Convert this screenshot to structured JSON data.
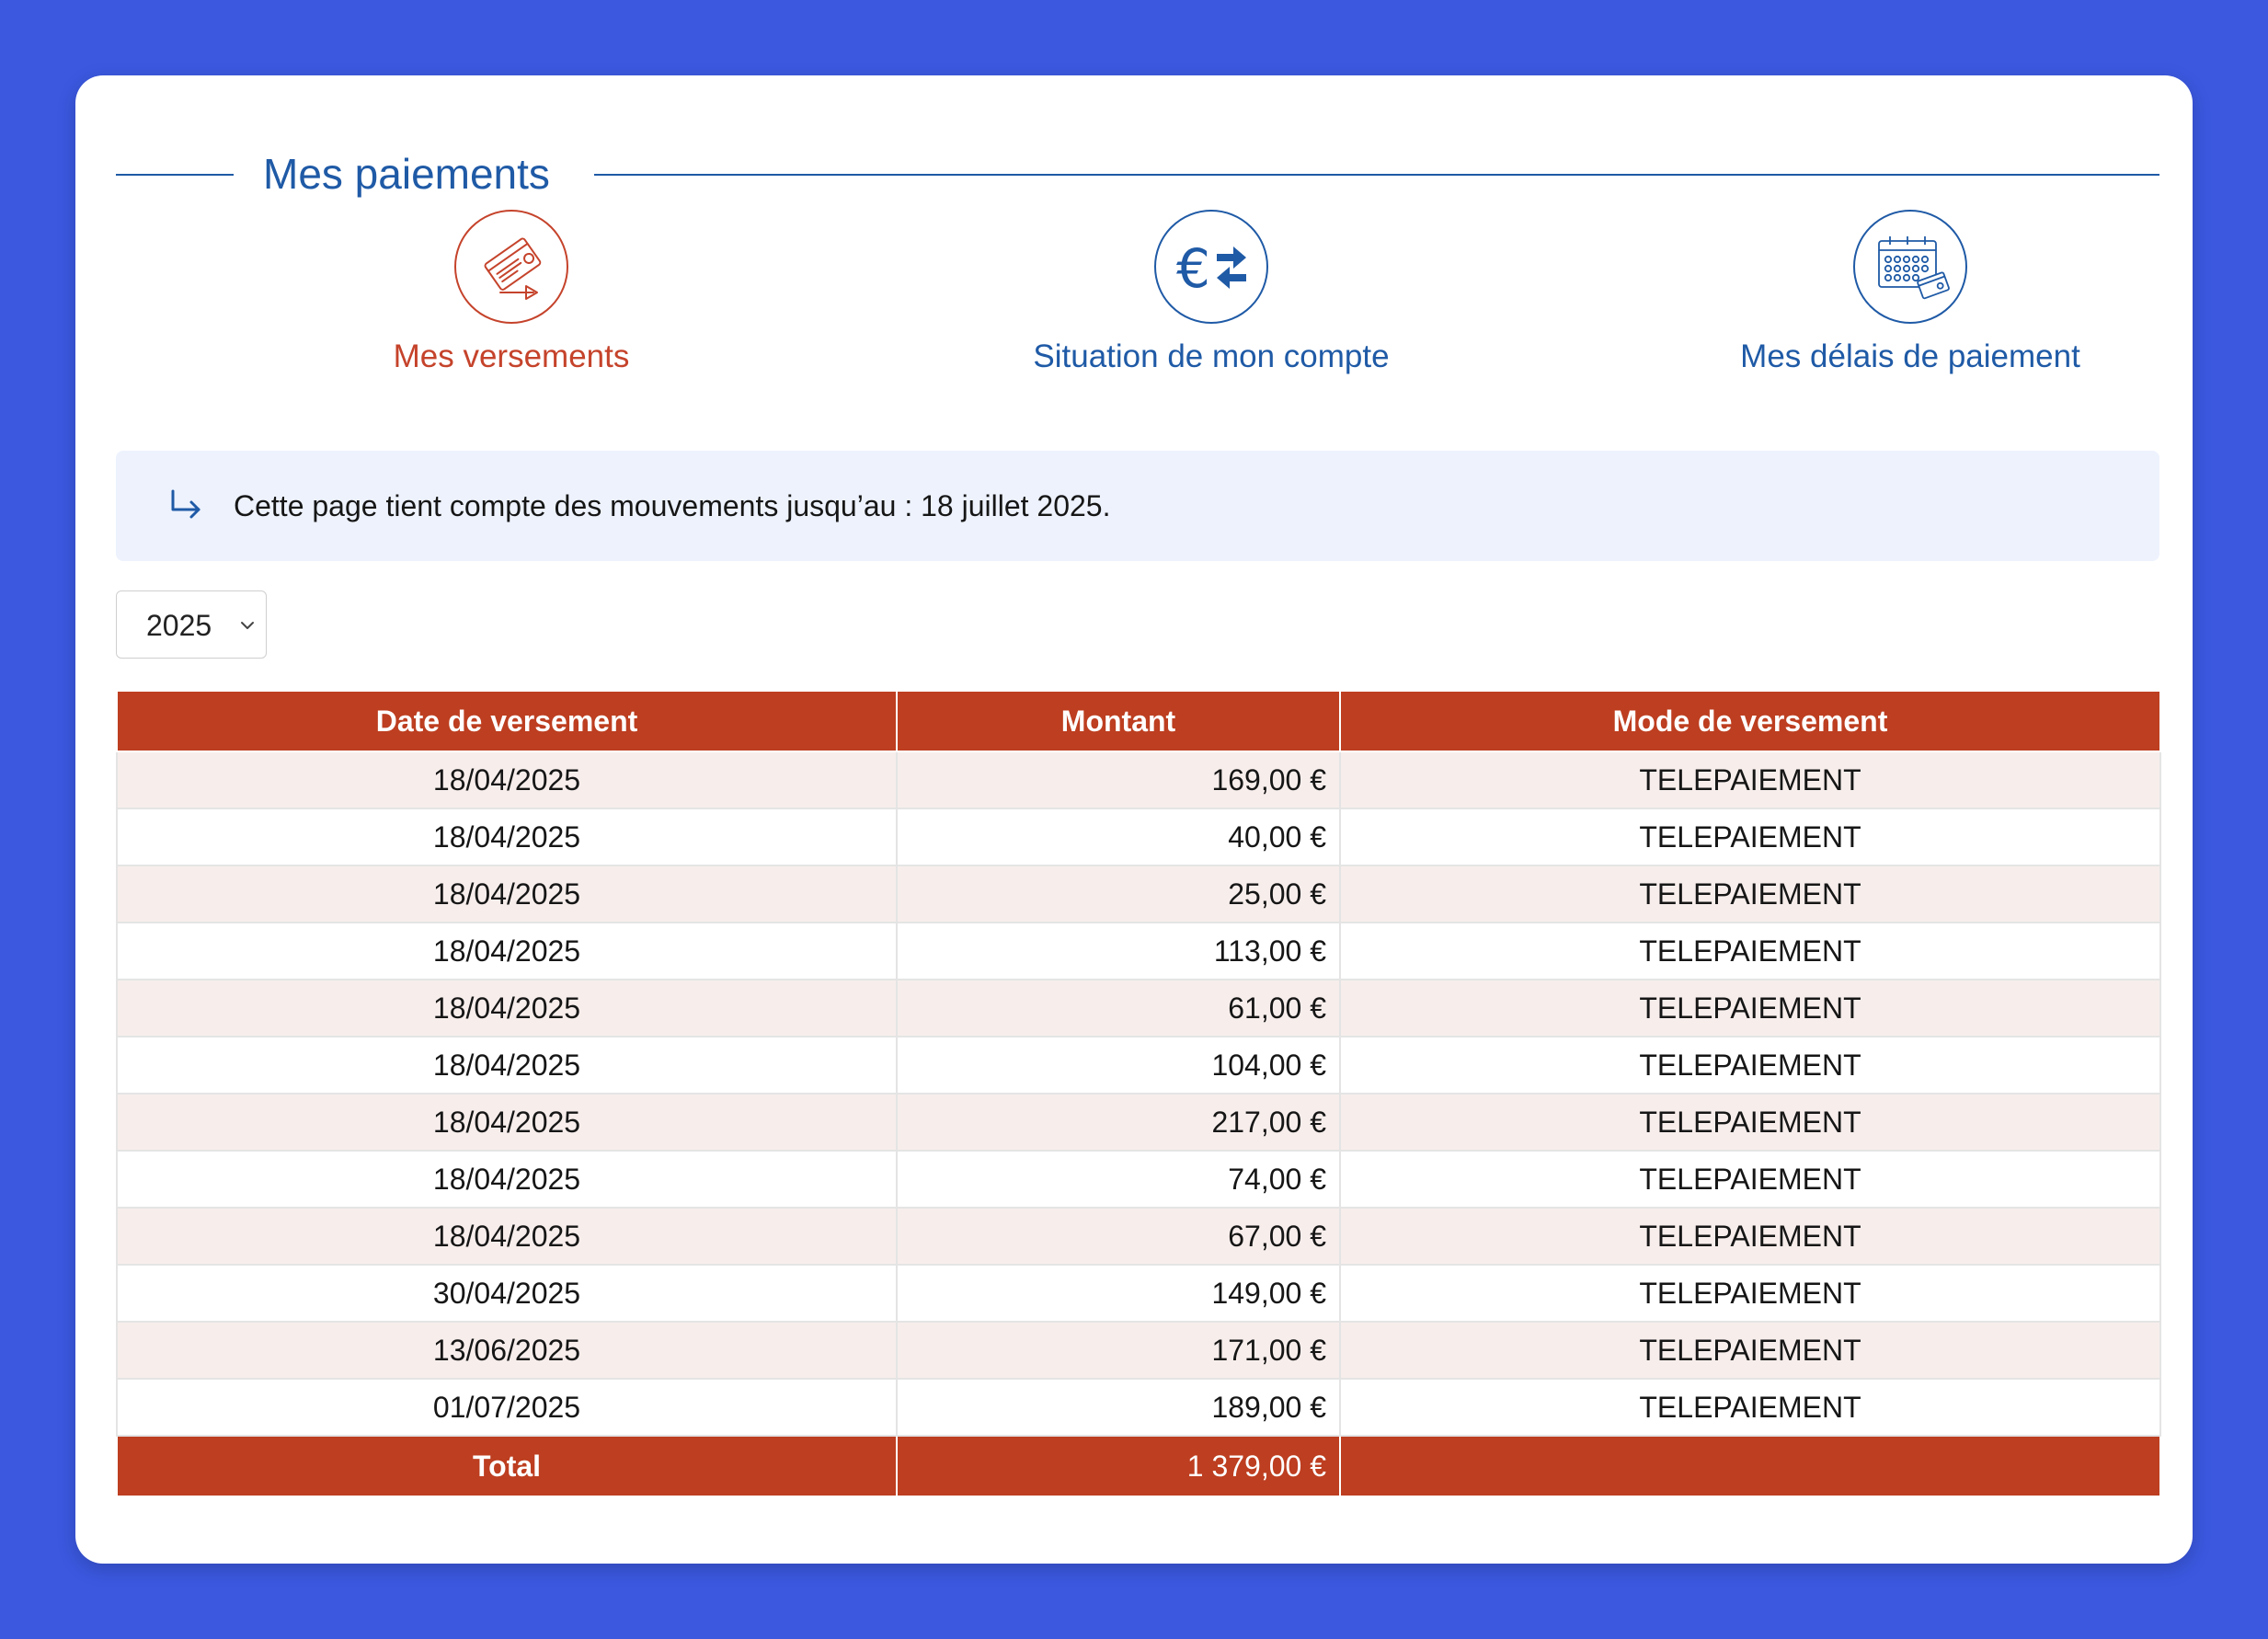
{
  "title": "Mes paiements",
  "nav": [
    {
      "label": "Mes versements",
      "icon": "credit-card-payment-icon"
    },
    {
      "label": "Situation de mon compte",
      "icon": "euro-exchange-icon"
    },
    {
      "label": "Mes délais de paiement",
      "icon": "calendar-payment-icon"
    }
  ],
  "info": {
    "text": "Cette page tient compte des mouvements jusqu’au : 18 juillet 2025.",
    "icon": "return-arrow-icon"
  },
  "year_select": {
    "value": "2025"
  },
  "table": {
    "headers": [
      "Date de versement",
      "Montant",
      "Mode de versement"
    ],
    "rows": [
      {
        "date": "18/04/2025",
        "amount": "169,00 €",
        "mode": "TELEPAIEMENT"
      },
      {
        "date": "18/04/2025",
        "amount": "40,00 €",
        "mode": "TELEPAIEMENT"
      },
      {
        "date": "18/04/2025",
        "amount": "25,00 €",
        "mode": "TELEPAIEMENT"
      },
      {
        "date": "18/04/2025",
        "amount": "113,00 €",
        "mode": "TELEPAIEMENT"
      },
      {
        "date": "18/04/2025",
        "amount": "61,00 €",
        "mode": "TELEPAIEMENT"
      },
      {
        "date": "18/04/2025",
        "amount": "104,00 €",
        "mode": "TELEPAIEMENT"
      },
      {
        "date": "18/04/2025",
        "amount": "217,00 €",
        "mode": "TELEPAIEMENT"
      },
      {
        "date": "18/04/2025",
        "amount": "74,00 €",
        "mode": "TELEPAIEMENT"
      },
      {
        "date": "18/04/2025",
        "amount": "67,00 €",
        "mode": "TELEPAIEMENT"
      },
      {
        "date": "30/04/2025",
        "amount": "149,00 €",
        "mode": "TELEPAIEMENT"
      },
      {
        "date": "13/06/2025",
        "amount": "171,00 €",
        "mode": "TELEPAIEMENT"
      },
      {
        "date": "01/07/2025",
        "amount": "189,00 €",
        "mode": "TELEPAIEMENT"
      }
    ],
    "total": {
      "label": "Total",
      "amount": "1 379,00 €",
      "mode": ""
    }
  },
  "colors": {
    "background": "#3b58df",
    "primary_blue": "#1f5aa6",
    "accent_red": "#bd3e20",
    "active_nav": "#c5432b",
    "info_bg": "#edf2fd",
    "row_alt": "#f7eeec"
  }
}
